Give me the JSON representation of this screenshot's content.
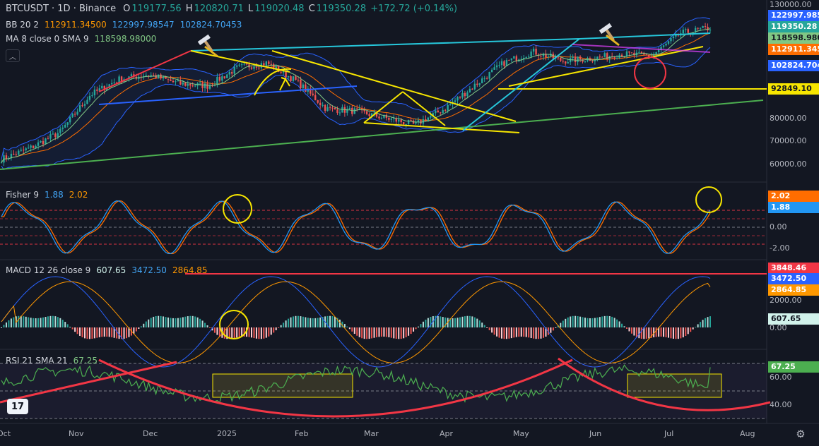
{
  "header": {
    "symbol": "BTCUSDT · 1D · Binance",
    "open_label": "O",
    "open": "119177.56",
    "high_label": "H",
    "high": "120820.71",
    "low_label": "L",
    "low": "119020.48",
    "close_label": "C",
    "close": "119350.28",
    "change": "+172.72 (+0.14%)"
  },
  "indicators": {
    "bb": {
      "name": "BB 20 2",
      "basis": "112911.34500",
      "upper": "122997.98547",
      "lower": "102824.70453"
    },
    "ma": {
      "name": "MA 8 close 0 SMA 9",
      "value": "118598.98000"
    },
    "fisher": {
      "name": "Fisher 9",
      "v1": "1.88",
      "v2": "2.02"
    },
    "macd": {
      "name": "MACD 12 26 close 9",
      "hist": "607.65",
      "macd": "3472.50",
      "signal": "2864.85"
    },
    "rsi": {
      "name": "RSI 21 SMA 21",
      "value": "67.25"
    }
  },
  "price_axis": {
    "labels": [
      "130000.00",
      "80000.00",
      "70000.00",
      "60000.00"
    ],
    "tags": [
      {
        "text": "122997.9854",
        "bg": "#2962ff",
        "fg": "#ffffff"
      },
      {
        "text": "119350.28",
        "bg": "#26a69a",
        "fg": "#ffffff"
      },
      {
        "text": "118598.9800",
        "bg": "#81c784",
        "fg": "#131722"
      },
      {
        "text": "112911.3450",
        "bg": "#ff6d00",
        "fg": "#ffffff"
      },
      {
        "text": "102824.7045",
        "bg": "#2962ff",
        "fg": "#ffffff"
      },
      {
        "text": "92849.10",
        "bg": "#f7e600",
        "fg": "#131722"
      }
    ]
  },
  "fisher_axis": {
    "labels": [
      "0.00",
      "-2.00"
    ],
    "tags": [
      {
        "text": "2.02",
        "bg": "#ff6d00",
        "fg": "#ffffff"
      },
      {
        "text": "1.88",
        "bg": "#2196f3",
        "fg": "#ffffff"
      }
    ]
  },
  "macd_axis": {
    "labels": [
      "2000.00",
      "0.00"
    ],
    "tags": [
      {
        "text": "3848.46",
        "bg": "#f23645",
        "fg": "#ffffff"
      },
      {
        "text": "3472.50",
        "bg": "#2962ff",
        "fg": "#ffffff"
      },
      {
        "text": "2864.85",
        "bg": "#ff9800",
        "fg": "#ffffff"
      },
      {
        "text": "607.65",
        "bg": "#d1f2eb",
        "fg": "#131722"
      }
    ]
  },
  "rsi_axis": {
    "labels": [
      "60.00",
      "40.00"
    ],
    "tags": [
      {
        "text": "67.25",
        "bg": "#4caf50",
        "fg": "#ffffff"
      }
    ]
  },
  "time_axis": [
    "Oct",
    "Nov",
    "Dec",
    "2025",
    "Feb",
    "Mar",
    "Apr",
    "May",
    "Jun",
    "Jul",
    "Aug"
  ],
  "colors": {
    "bg": "#131722",
    "up": "#26a69a",
    "down": "#ef5350",
    "bb_basis": "#ff6d00",
    "bb_band": "#2962ff",
    "ma": "#81c784",
    "fisher": "#2196f3",
    "fisher_trigger": "#ff6d00",
    "rsi": "#4caf50",
    "annotation_yellow": "#f7e600",
    "annotation_red": "#f23645",
    "annotation_cyan": "#26c6da",
    "annotation_green": "#4caf50"
  },
  "icons": [
    "hammer-icon",
    "tradingview-logo-icon",
    "settings-icon",
    "chevron-up-icon"
  ],
  "chart_data": {
    "type": "candlestick",
    "series": [
      {
        "name": "BTCUSDT",
        "approx_close_path": [
          62000,
          67000,
          74000,
          90000,
          97000,
          99000,
          95000,
          94000,
          102000,
          104000,
          96000,
          84000,
          83000,
          80000,
          77000,
          84000,
          94000,
          104000,
          109000,
          105000,
          106000,
          108000,
          107000,
          117000,
          119350
        ]
      }
    ],
    "ylim": [
      55000,
      130000
    ],
    "horizontal_levels": [
      92849.1
    ]
  }
}
